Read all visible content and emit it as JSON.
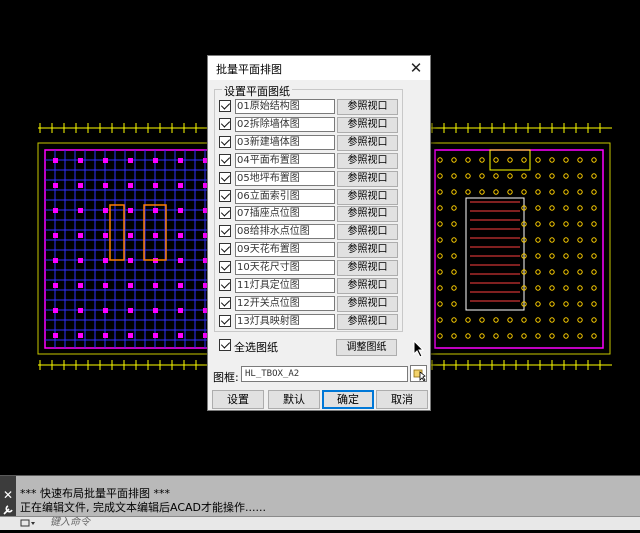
{
  "dialog": {
    "title": "批量平面排图",
    "close_glyph": "✕",
    "group_label": "设置平面图纸",
    "drawings": [
      {
        "name": "01原始结构图",
        "button": "参照视口"
      },
      {
        "name": "02拆除墙体图",
        "button": "参照视口"
      },
      {
        "name": "03新建墙体图",
        "button": "参照视口"
      },
      {
        "name": "04平面布置图",
        "button": "参照视口"
      },
      {
        "name": "05地坪布置图",
        "button": "参照视口"
      },
      {
        "name": "06立面索引图",
        "button": "参照视口"
      },
      {
        "name": "07插座点位图",
        "button": "参照视口"
      },
      {
        "name": "08给排水点位图",
        "button": "参照视口"
      },
      {
        "name": "09天花布置图",
        "button": "参照视口"
      },
      {
        "name": "10天花尺寸图",
        "button": "参照视口"
      },
      {
        "name": "11灯具定位图",
        "button": "参照视口"
      },
      {
        "name": "12开关点位图",
        "button": "参照视口"
      },
      {
        "name": "13灯具映射图",
        "button": "参照视口"
      }
    ],
    "select_all_label": "全选图纸",
    "adjust_button": "调整图纸",
    "frame_label": "图框:",
    "frame_value": "HL_TBOX_A2",
    "buttons": {
      "settings": "设置",
      "default": "默认",
      "ok": "确定",
      "cancel": "取消"
    }
  },
  "command": {
    "lines": [
      "***  快速布局批量平面排图  ***",
      "正在编辑文件, 完成文本编辑后ACAD才能操作......"
    ],
    "close_glyph": "✕",
    "prompt_placeholder": "键入命令"
  },
  "colors": {
    "cad_background": "#000000",
    "dialog_bg": "#f0f0f0",
    "accent": "#0078d7"
  }
}
